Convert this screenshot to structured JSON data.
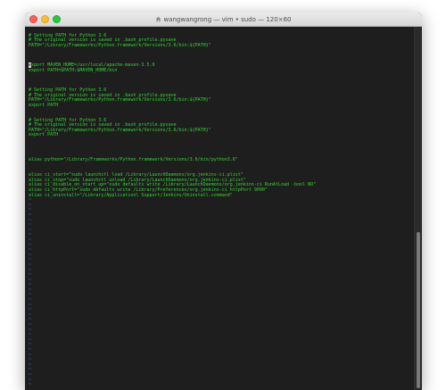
{
  "window": {
    "title": "wangwangrong — vim • sudo — 120×60",
    "colors": {
      "text": "#33d633",
      "tilde": "#3b7dd8",
      "background": "#1e1e1e"
    }
  },
  "editor": {
    "lines": [
      "",
      "# Setting PATH for Python 3.6",
      "# The original version is saved in .bash_profile.pysave",
      "PATH=\"/Library/Frameworks/Python.framework/Versions/3.6/bin:${PATH}\"",
      "",
      "",
      "",
      "export MAVEN_HOME=/usr/local/apache-maven-3.5.0",
      "export PATH=$PATH:$MAVEN_HOME/bin",
      "",
      "",
      "",
      "# Setting PATH for Python 3.6",
      "# The original version is saved in .bash_profile.pysave",
      "PATH=\"/Library/Frameworks/Python.framework/Versions/3.6/bin:${PATH}\"",
      "export PATH",
      "",
      "",
      "# Setting PATH for Python 3.6",
      "# The original version is saved in .bash_profile.pysave",
      "PATH=\"/Library/Frameworks/Python.framework/Versions/3.6/bin:${PATH}\"",
      "export PATH",
      "",
      "",
      "",
      "",
      "alias python=\"/Library/Frameworks/Python.framework/Versions/3.6/bin/python3.6\"",
      "",
      "",
      "alias ci_start=\"sudo launchctl load /Library/LaunchDaemons/org.jenkins-ci.plist\"",
      "alias ci_stop=\"sudo launchctl unload /Library/LaunchDaemons/org.jenkins-ci.plist\"",
      "alias ci_disable_on_start_up=\"sudo defaults write /Library/LaunchDaemons/org.jenkins-ci RunAtLoad -bool NO\"",
      "alias ci_httpPort=\"sudo defaults write /Library/Preferences/org.jenkins-ci httpPort 9090\"",
      "alias ci_uninstall=\"/Library/Application\\ Support/Jenkins/Uninstall.command\""
    ],
    "cursor_line": 7,
    "tilde_lines": 38,
    "tilde_char": "~"
  }
}
